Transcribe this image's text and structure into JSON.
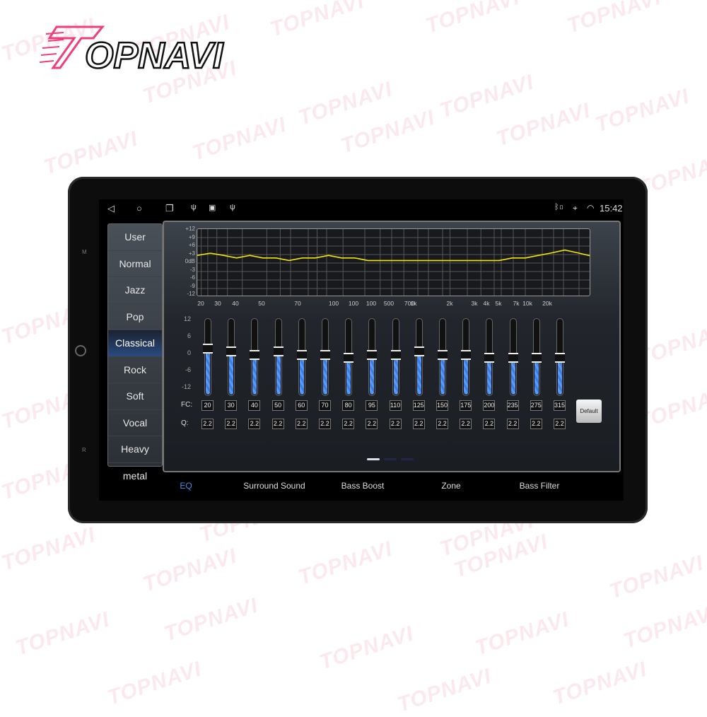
{
  "brand": {
    "logo_text": "TOPNAVI",
    "watermark": "TOPNAVI",
    "accent": "#ee3f7b"
  },
  "status_bar": {
    "time": "15:42",
    "left_icons": [
      "back-icon",
      "home-icon",
      "recents-icon",
      "usb-icon",
      "image-icon",
      "usb-icon"
    ],
    "right_icons": [
      "bluetooth-icon",
      "location-icon",
      "wifi-icon"
    ]
  },
  "hardware_labels": {
    "top": "M",
    "bottom": "R"
  },
  "presets": {
    "selected": "Classical",
    "items": [
      "User",
      "Normal",
      "Jazz",
      "Pop",
      "Classical",
      "Rock",
      "Soft",
      "Vocal",
      "Heavy metal"
    ]
  },
  "graph": {
    "db_ticks": [
      "+12",
      "+9",
      "+6",
      "+3",
      "0dB",
      "-3",
      "-6",
      "-9",
      "-12"
    ],
    "freq_labels": [
      "20",
      "30",
      "40",
      "50",
      "70",
      "100",
      "100",
      "100",
      "500",
      "700",
      "1k",
      "2k",
      "3k",
      "4k",
      "5k",
      "7k",
      "10k",
      "20k"
    ],
    "curve_color": "#f2e600",
    "curve_db": [
      2.7,
      3.5,
      2.7,
      1.8,
      2.7,
      1.8,
      1.8,
      0.9,
      1.8,
      1.8,
      2.7,
      1.8,
      1.8,
      0.9,
      0.9,
      0.9,
      0.9,
      0.9,
      0.9,
      0.9,
      0.9,
      0.9,
      0.9,
      0.9,
      1.8,
      1.8,
      2.7,
      3.6,
      4.6,
      3.6,
      2.5
    ]
  },
  "sliders": {
    "scale": [
      "12",
      "6",
      "0",
      "-6",
      "-12"
    ],
    "range_db": [
      -12,
      12
    ],
    "gains_db": [
      3,
      2,
      1,
      2,
      1,
      1,
      0,
      1,
      1,
      2,
      1,
      1,
      0,
      0,
      0,
      0
    ],
    "fc_label": "FC:",
    "q_label": "Q:",
    "fc": [
      "20",
      "30",
      "40",
      "50",
      "60",
      "70",
      "80",
      "95",
      "110",
      "125",
      "150",
      "175",
      "200",
      "235",
      "275",
      "315"
    ],
    "q": [
      "2.2",
      "2.2",
      "2.2",
      "2.2",
      "2.2",
      "2.2",
      "2.2",
      "2.2",
      "2.2",
      "2.2",
      "2.2",
      "2.2",
      "2.2",
      "2.2",
      "2.2",
      "2.2"
    ],
    "fill_color": "#3b7ee6"
  },
  "default_button": "Default",
  "page_indicator": {
    "pages": 3,
    "current": 1
  },
  "tabs": {
    "active": "EQ",
    "active_color": "#3a8ee8",
    "items": [
      "EQ",
      "Surround Sound",
      "Bass Boost",
      "Zone",
      "Bass Filter"
    ]
  }
}
